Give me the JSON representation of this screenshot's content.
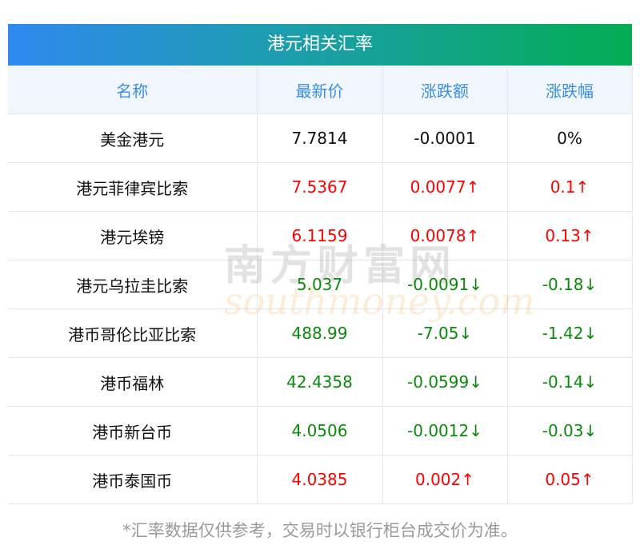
{
  "title": "港元相关汇率",
  "columns": [
    "名称",
    "最新价",
    "涨跌额",
    "涨跌幅"
  ],
  "rows": [
    {
      "name": "美金港元",
      "price": "7.7814",
      "change": "-0.0001",
      "pct": "0%",
      "trend": "flat"
    },
    {
      "name": "港元菲律宾比索",
      "price": "7.5367",
      "change": "0.0077↑",
      "pct": "0.1↑",
      "trend": "up"
    },
    {
      "name": "港元埃镑",
      "price": "6.1159",
      "change": "0.0078↑",
      "pct": "0.13↑",
      "trend": "up"
    },
    {
      "name": "港元乌拉圭比索",
      "price": "5.037",
      "change": "-0.0091↓",
      "pct": "-0.18↓",
      "trend": "down"
    },
    {
      "name": "港币哥伦比亚比索",
      "price": "488.99",
      "change": "-7.05↓",
      "pct": "-1.42↓",
      "trend": "down"
    },
    {
      "name": "港币福林",
      "price": "42.4358",
      "change": "-0.0599↓",
      "pct": "-0.14↓",
      "trend": "down"
    },
    {
      "name": "港币新台币",
      "price": "4.0506",
      "change": "-0.0012↓",
      "pct": "-0.03↓",
      "trend": "down"
    },
    {
      "name": "港币泰国币",
      "price": "4.0385",
      "change": "0.002↑",
      "pct": "0.05↑",
      "trend": "up"
    }
  ],
  "footer": "*汇率数据仅供参考，交易时以银行柜台成交价为准。",
  "watermark": {
    "cn": "南方财富网",
    "en": "southmoney.com"
  },
  "colors": {
    "up": "#ff0000",
    "down": "#0a8a0a",
    "header_text": "#3a8ee6"
  }
}
